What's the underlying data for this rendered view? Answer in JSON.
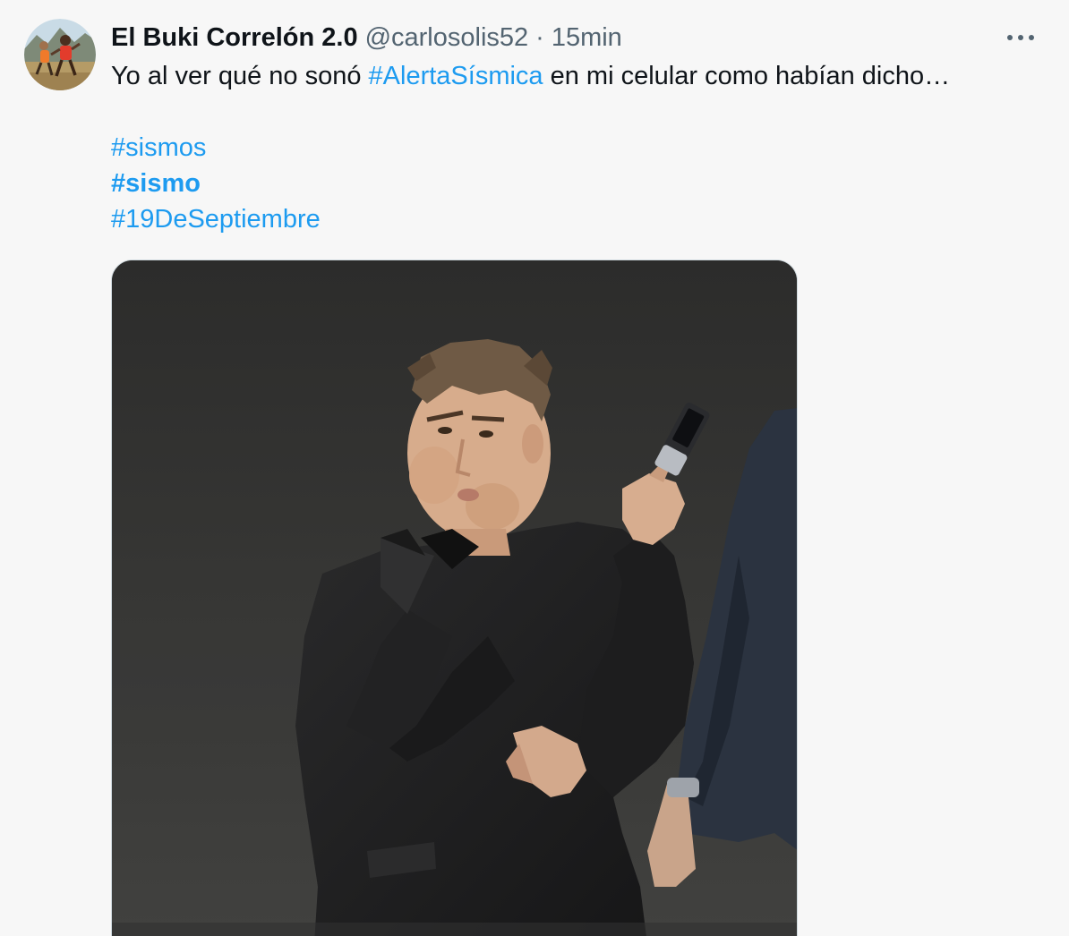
{
  "tweet": {
    "display_name": "El Buki Correlón 2.0",
    "handle": "@carlosolis52",
    "separator": "·",
    "time": "15min",
    "text_before": "Yo al ver qué no sonó ",
    "hashtag_inline": "#AlertaSísmica",
    "text_after": " en mi celular como habían dicho…",
    "hashtags": [
      {
        "text": "#sismos",
        "bold": false
      },
      {
        "text": "#sismo",
        "bold": true
      },
      {
        "text": "#19DeSeptiembre",
        "bold": false
      }
    ]
  },
  "icons": {
    "more": "more-horizontal-icon",
    "avatar": "avatar-image",
    "media": "meme-photo-man-throwing-phone"
  },
  "colors": {
    "background": "#f7f7f7",
    "text": "#0f1419",
    "secondary": "#536471",
    "link": "#1d9bf0",
    "media_border": "#cfd9de"
  }
}
